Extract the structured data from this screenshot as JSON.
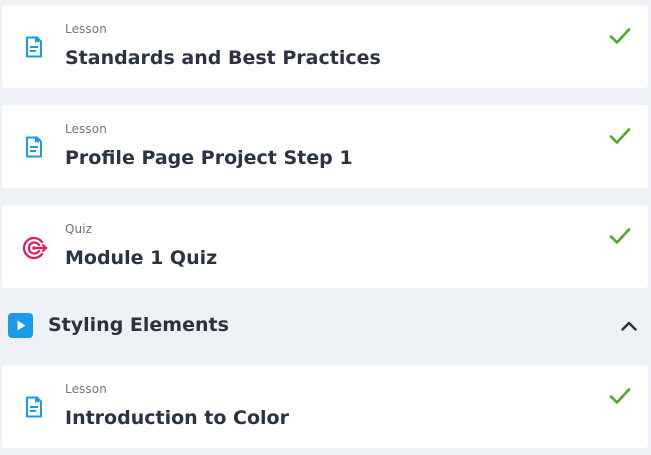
{
  "items": [
    {
      "type": "Lesson",
      "title": "Standards and Best Practices",
      "icon": "lesson-icon",
      "completed": true
    },
    {
      "type": "Lesson",
      "title": "Profile Page Project Step 1",
      "icon": "lesson-icon",
      "completed": true
    },
    {
      "type": "Quiz",
      "title": "Module 1 Quiz",
      "icon": "quiz-target-icon",
      "completed": true
    }
  ],
  "section": {
    "title": "Styling Elements",
    "icon": "play-icon",
    "expanded": true
  },
  "section_items": [
    {
      "type": "Lesson",
      "title": "Introduction to Color",
      "icon": "lesson-icon",
      "completed": true
    }
  ],
  "colors": {
    "lesson_icon": "#1a9bea",
    "quiz_icon": "#e2185b",
    "check": "#4aa928",
    "section_icon_bg": "#1a9bea",
    "text": "#2a3441",
    "muted": "#6b7785",
    "background": "#eef1f5"
  }
}
